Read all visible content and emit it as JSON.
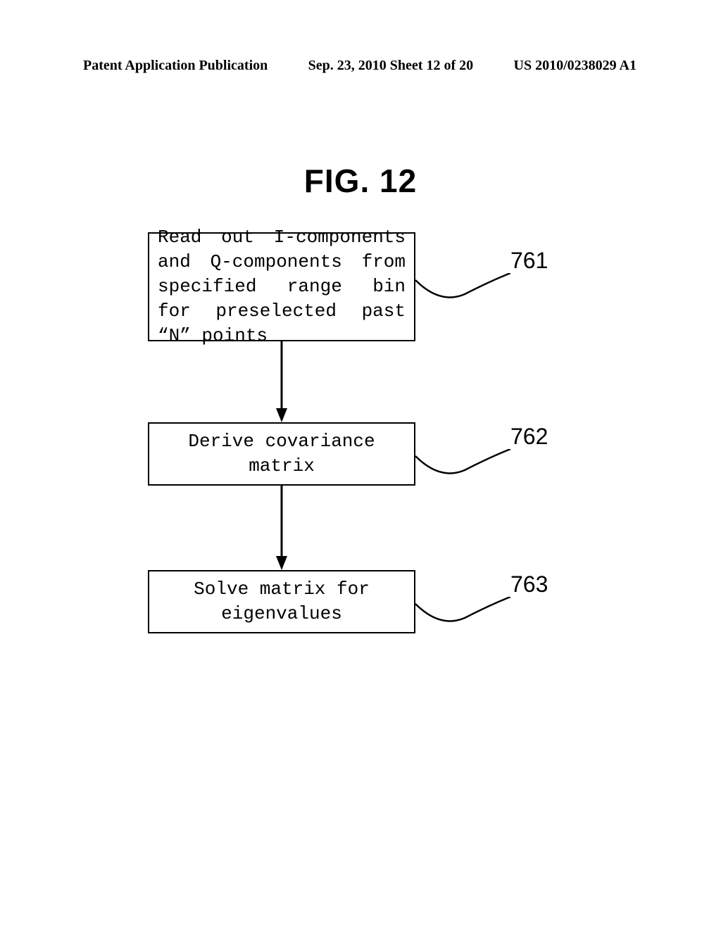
{
  "header": {
    "left": "Patent Application Publication",
    "center": "Sep. 23, 2010  Sheet 12 of 20",
    "right": "US 2010/0238029 A1"
  },
  "figure_title": "FIG. 12",
  "boxes": {
    "b1": "Read out I-components and Q-components from specified range bin for preselected past “N” points",
    "b2": "Derive covariance matrix",
    "b3": "Solve matrix for eigenvalues"
  },
  "labels": {
    "l1": "761",
    "l2": "762",
    "l3": "763"
  }
}
